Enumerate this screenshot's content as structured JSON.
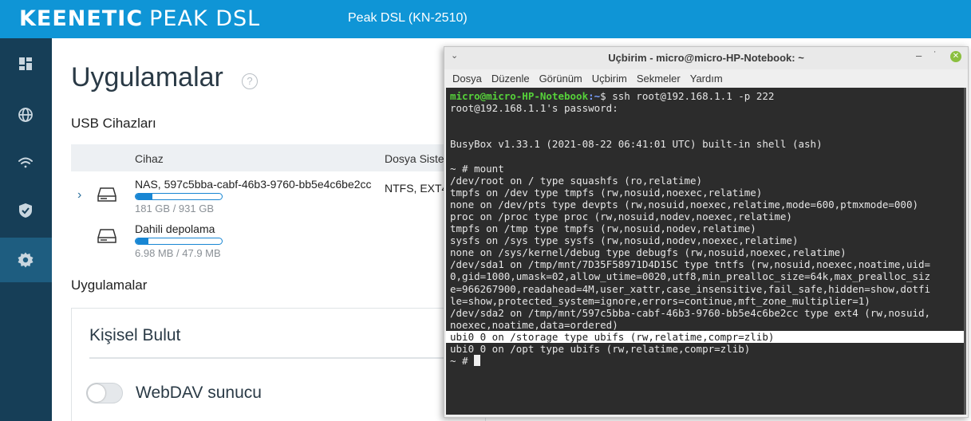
{
  "header": {
    "brand_bold": "KEENETIC",
    "brand_light": "PEAK DSL",
    "model": "Peak DSL (KN-2510)",
    "bg_color": "#0f95d6"
  },
  "sidebar": {
    "bg_color": "#163e57",
    "items": [
      {
        "icon": "dashboard-icon",
        "active": false
      },
      {
        "icon": "globe-icon",
        "active": false
      },
      {
        "icon": "wifi-icon",
        "active": false
      },
      {
        "icon": "shield-icon",
        "active": false
      },
      {
        "icon": "gear-icon",
        "active": true
      }
    ]
  },
  "main": {
    "title": "Uygulamalar",
    "help_icon": "?",
    "usb_section_title": "USB Cihazları",
    "table": {
      "headers": [
        "Cihaz",
        "Dosya Sisten"
      ],
      "rows": [
        {
          "name": "NAS, 597c5bba-cabf-46b3-9760-bb5e4c6be2cc",
          "size": "181 GB / 931 GB",
          "usage_fraction": 0.19,
          "fs": "NTFS, EXT4",
          "expandable": true
        },
        {
          "name": "Dahili depolama",
          "size": "6.98 MB / 47.9 MB",
          "usage_fraction": 0.15,
          "fs": "",
          "expandable": false
        }
      ]
    },
    "apps_section_title": "Uygulamalar",
    "card": {
      "title": "Kişisel Bulut",
      "toggle_label": "WebDAV sunucu",
      "toggle_on": false
    }
  },
  "terminal": {
    "title": "Uçbirim - micro@micro-HP-Notebook: ~",
    "menu": [
      "Dosya",
      "Düzenle",
      "Görünüm",
      "Uçbirim",
      "Sekmeler",
      "Yardım"
    ],
    "prompt_user": "micro@micro-HP-Notebook",
    "prompt_path": ":~",
    "prompt_cmd": "$ ssh root@192.168.1.1 -p 222",
    "lines": [
      "root@192.168.1.1's password:",
      "",
      "",
      "BusyBox v1.33.1 (2021-08-22 06:41:01 UTC) built-in shell (ash)",
      "",
      "~ # mount",
      "/dev/root on / type squashfs (ro,relatime)",
      "tmpfs on /dev type tmpfs (rw,nosuid,noexec,relatime)",
      "none on /dev/pts type devpts (rw,nosuid,noexec,relatime,mode=600,ptmxmode=000)",
      "proc on /proc type proc (rw,nosuid,nodev,noexec,relatime)",
      "tmpfs on /tmp type tmpfs (rw,nosuid,nodev,relatime)",
      "sysfs on /sys type sysfs (rw,nosuid,nodev,noexec,relatime)",
      "none on /sys/kernel/debug type debugfs (rw,nosuid,noexec,relatime)",
      "/dev/sda1 on /tmp/mnt/7D35F58971D4D15C type tntfs (rw,nosuid,noexec,noatime,uid=",
      "0,gid=1000,umask=02,allow_utime=0020,utf8,min_prealloc_size=64k,max_prealloc_siz",
      "e=966267900,readahead=4M,user_xattr,case_insensitive,fail_safe,hidden=show,dotfi",
      "le=show,protected_system=ignore,errors=continue,mft_zone_multiplier=1)",
      "/dev/sda2 on /tmp/mnt/597c5bba-cabf-46b3-9760-bb5e4c6be2cc type ext4 (rw,nosuid,",
      "noexec,noatime,data=ordered)",
      "ubi0 0 on /storage type ubifs (rw,relatime,compr=zlib)",
      "ubi0 0 on /opt type ubifs (rw,relatime,compr=zlib)"
    ],
    "highlighted_line": "ubi0 0 on /storage type ubifs (rw,relatime,compr=zlib)",
    "final_prompt": "~ # "
  }
}
